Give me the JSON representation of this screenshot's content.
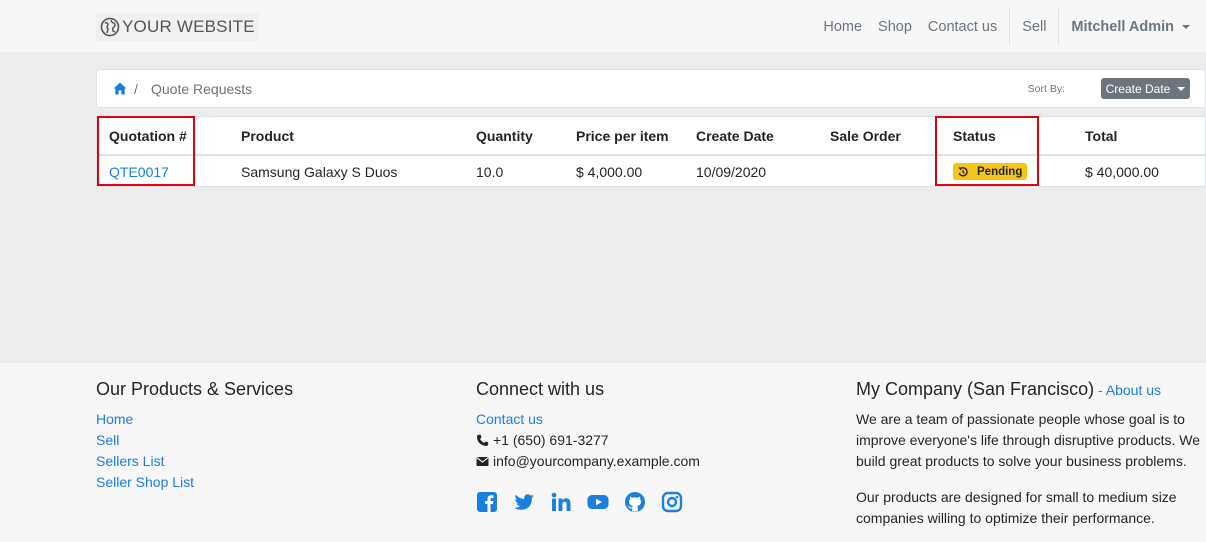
{
  "header": {
    "logo_text": "YOUR WEBSITE",
    "nav": [
      "Home",
      "Shop",
      "Contact us",
      "Sell"
    ],
    "user": "Mitchell Admin"
  },
  "breadcrumb": {
    "current": "Quote Requests",
    "separator": "/"
  },
  "sort": {
    "label": "Sort By:",
    "value": "Create Date"
  },
  "table": {
    "headers": [
      "Quotation #",
      "Product",
      "Quantity",
      "Price per item",
      "Create Date",
      "Sale Order",
      "Status",
      "Total"
    ],
    "rows": [
      {
        "quotation": "QTE0017",
        "product": "Samsung Galaxy S Duos",
        "quantity": "10.0",
        "price": "$ 4,000.00",
        "create_date": "10/09/2020",
        "sale_order": "",
        "status": "Pending",
        "total": "$ 40,000.00"
      }
    ]
  },
  "footer": {
    "products": {
      "title": "Our Products & Services",
      "links": [
        "Home",
        "Sell",
        "Sellers List",
        "Seller Shop List"
      ]
    },
    "connect": {
      "title": "Connect with us",
      "contact_link": "Contact us",
      "phone": "+1 (650) 691-3277",
      "email": "info@yourcompany.example.com",
      "social": [
        "facebook-icon",
        "twitter-icon",
        "linkedin-icon",
        "youtube-icon",
        "github-icon",
        "instagram-icon"
      ]
    },
    "company": {
      "title": "My Company (San Francisco)",
      "dash": " - ",
      "about_link": "About us",
      "para1": "We are a team of passionate people whose goal is to improve everyone's life through disruptive products. We build great products to solve your business problems.",
      "para2": "Our products are designed for small to medium size companies willing to optimize their performance."
    }
  },
  "colors": {
    "link": "#1b7fe0",
    "badge_pending": "#f5c518",
    "highlight": "#e3000f",
    "sort_button": "#6c757d"
  }
}
